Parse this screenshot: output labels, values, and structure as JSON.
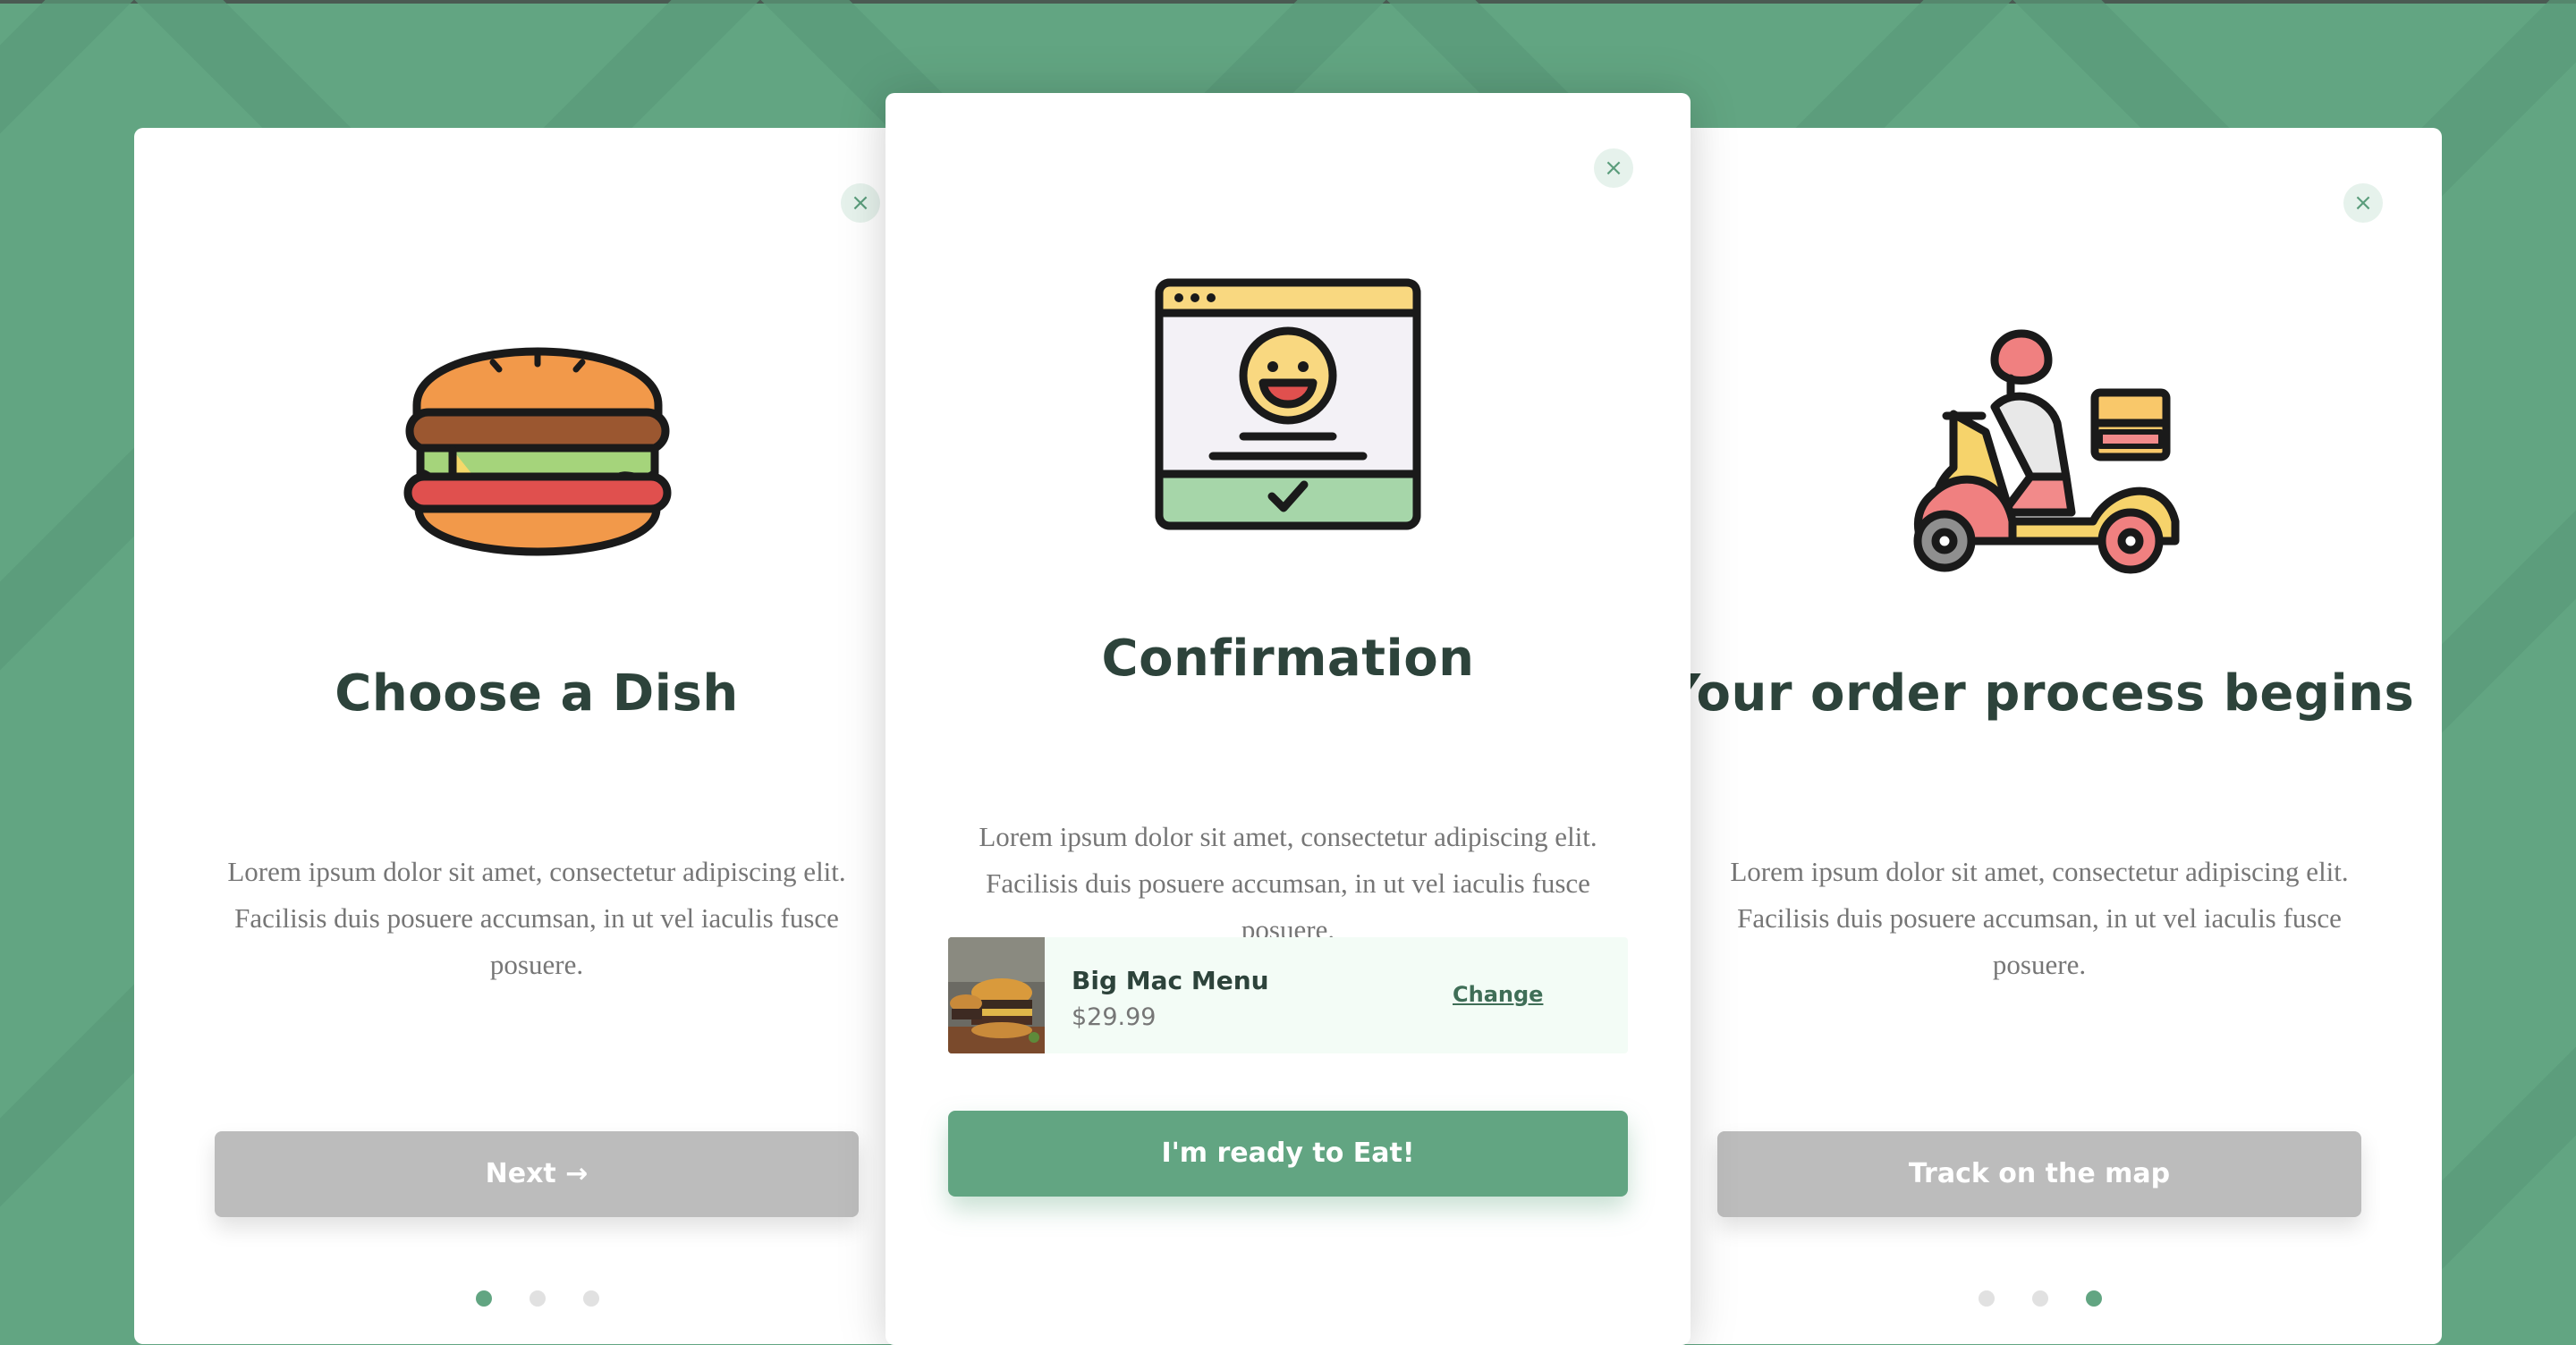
{
  "colors": {
    "background": "#62a582",
    "accent": "#62a582",
    "disabled_button": "#bcbcbc",
    "title": "#2d433b",
    "body_text": "#767676"
  },
  "cards": [
    {
      "title": "Choose a Dish",
      "description": "Lorem ipsum dolor sit amet, consectetur adipiscing elit. Facilisis duis posuere accumsan, in ut vel iaculis fusce posuere.",
      "button_label": "Next →",
      "illustration": "burger-icon",
      "close_label": "×",
      "active_step": 1
    },
    {
      "title": "Confirmation",
      "description": "Lorem ipsum dolor sit amet, consectetur adipiscing elit. Facilisis duis posuere accumsan, in ut vel iaculis fusce posuere.",
      "button_label": "I'm ready to Eat!",
      "illustration": "browser-smiley-icon",
      "close_label": "×",
      "order": {
        "name": "Big Mac Menu",
        "price": "$29.99",
        "change_label": "Change"
      }
    },
    {
      "title": "Your order process begins",
      "description": "Lorem ipsum dolor sit amet, consectetur adipiscing elit. Facilisis duis posuere accumsan, in ut vel iaculis fusce posuere.",
      "button_label": "Track on the map",
      "illustration": "scooter-delivery-icon",
      "close_label": "×",
      "active_step": 3
    }
  ],
  "steps_total": 3
}
